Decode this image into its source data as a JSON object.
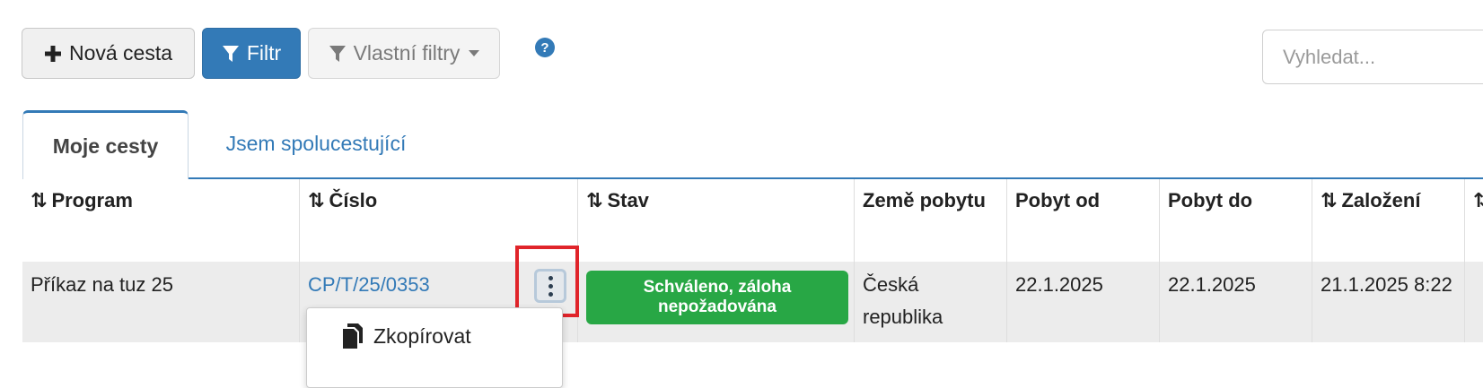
{
  "toolbar": {
    "new_trip_label": "Nová cesta",
    "filter_label": "Filtr",
    "custom_filters_label": "Vlastní filtry",
    "help_label": "?",
    "search_placeholder": "Vyhledat..."
  },
  "tabs": [
    {
      "label": "Moje cesty",
      "active": true
    },
    {
      "label": "Jsem spolucestující",
      "active": false
    }
  ],
  "table": {
    "sort_glyph": "⇅",
    "columns": [
      {
        "label": "Program",
        "sortable": true
      },
      {
        "label": "Číslo",
        "sortable": true
      },
      {
        "label": "Stav",
        "sortable": true
      },
      {
        "label": "Země pobytu",
        "sortable": false
      },
      {
        "label": "Pobyt od",
        "sortable": false
      },
      {
        "label": "Pobyt do",
        "sortable": false
      },
      {
        "label": "Založení",
        "sortable": true
      }
    ],
    "rows": [
      {
        "program": "Příkaz na tuz 25",
        "number": "CP/T/25/0353",
        "status": "Schváleno, záloha nepožadována",
        "country": "Česká republika",
        "stay_from": "22.1.2025",
        "stay_to": "22.1.2025",
        "created": "21.1.2025 8:22"
      }
    ]
  },
  "row_menu": {
    "items": [
      {
        "label": "Zkopírovat",
        "icon": "copy-icon"
      }
    ]
  },
  "colors": {
    "primary": "#337ab7",
    "success": "#28a745",
    "highlight": "#e0242a"
  }
}
